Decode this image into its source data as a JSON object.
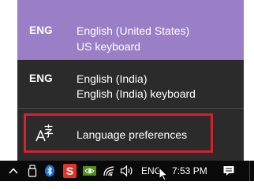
{
  "flyout": {
    "languages": [
      {
        "code": "ENG",
        "name": "English (United States)",
        "keyboard": "US keyboard",
        "selected": true
      },
      {
        "code": "ENG",
        "name": "English (India)",
        "keyboard": "English (India) keyboard",
        "selected": false
      }
    ],
    "preferences_label": "Language preferences",
    "preferences_icon": "language-settings-icon",
    "colors": {
      "selected_bg": "#9b7fc6",
      "flyout_bg": "#2b2b2b",
      "highlight_border": "#d6202c"
    }
  },
  "taskbar": {
    "tray_icons": [
      "chevron-up-icon",
      "usb-drive-icon",
      "bluetooth-icon",
      "red-s-app-icon",
      "nvidia-icon",
      "wifi-icon",
      "volume-icon"
    ],
    "language_indicator": "ENG",
    "clock": "7:53 PM",
    "notification_icon": "action-center-icon",
    "background_color": "#0a0a0a"
  }
}
